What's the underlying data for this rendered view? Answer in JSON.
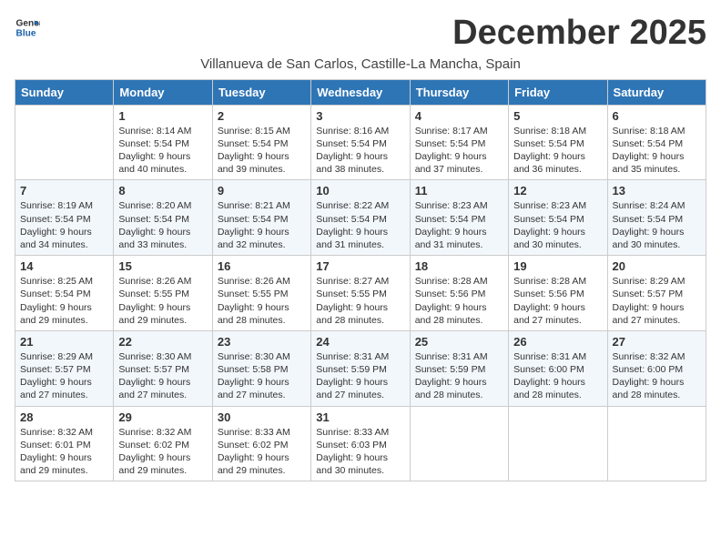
{
  "logo": {
    "line1": "General",
    "line2": "Blue"
  },
  "title": "December 2025",
  "subtitle": "Villanueva de San Carlos, Castille-La Mancha, Spain",
  "days_of_week": [
    "Sunday",
    "Monday",
    "Tuesday",
    "Wednesday",
    "Thursday",
    "Friday",
    "Saturday"
  ],
  "weeks": [
    [
      {
        "day": "",
        "content": ""
      },
      {
        "day": "1",
        "content": "Sunrise: 8:14 AM\nSunset: 5:54 PM\nDaylight: 9 hours\nand 40 minutes."
      },
      {
        "day": "2",
        "content": "Sunrise: 8:15 AM\nSunset: 5:54 PM\nDaylight: 9 hours\nand 39 minutes."
      },
      {
        "day": "3",
        "content": "Sunrise: 8:16 AM\nSunset: 5:54 PM\nDaylight: 9 hours\nand 38 minutes."
      },
      {
        "day": "4",
        "content": "Sunrise: 8:17 AM\nSunset: 5:54 PM\nDaylight: 9 hours\nand 37 minutes."
      },
      {
        "day": "5",
        "content": "Sunrise: 8:18 AM\nSunset: 5:54 PM\nDaylight: 9 hours\nand 36 minutes."
      },
      {
        "day": "6",
        "content": "Sunrise: 8:18 AM\nSunset: 5:54 PM\nDaylight: 9 hours\nand 35 minutes."
      }
    ],
    [
      {
        "day": "7",
        "content": "Sunrise: 8:19 AM\nSunset: 5:54 PM\nDaylight: 9 hours\nand 34 minutes."
      },
      {
        "day": "8",
        "content": "Sunrise: 8:20 AM\nSunset: 5:54 PM\nDaylight: 9 hours\nand 33 minutes."
      },
      {
        "day": "9",
        "content": "Sunrise: 8:21 AM\nSunset: 5:54 PM\nDaylight: 9 hours\nand 32 minutes."
      },
      {
        "day": "10",
        "content": "Sunrise: 8:22 AM\nSunset: 5:54 PM\nDaylight: 9 hours\nand 31 minutes."
      },
      {
        "day": "11",
        "content": "Sunrise: 8:23 AM\nSunset: 5:54 PM\nDaylight: 9 hours\nand 31 minutes."
      },
      {
        "day": "12",
        "content": "Sunrise: 8:23 AM\nSunset: 5:54 PM\nDaylight: 9 hours\nand 30 minutes."
      },
      {
        "day": "13",
        "content": "Sunrise: 8:24 AM\nSunset: 5:54 PM\nDaylight: 9 hours\nand 30 minutes."
      }
    ],
    [
      {
        "day": "14",
        "content": "Sunrise: 8:25 AM\nSunset: 5:54 PM\nDaylight: 9 hours\nand 29 minutes."
      },
      {
        "day": "15",
        "content": "Sunrise: 8:26 AM\nSunset: 5:55 PM\nDaylight: 9 hours\nand 29 minutes."
      },
      {
        "day": "16",
        "content": "Sunrise: 8:26 AM\nSunset: 5:55 PM\nDaylight: 9 hours\nand 28 minutes."
      },
      {
        "day": "17",
        "content": "Sunrise: 8:27 AM\nSunset: 5:55 PM\nDaylight: 9 hours\nand 28 minutes."
      },
      {
        "day": "18",
        "content": "Sunrise: 8:28 AM\nSunset: 5:56 PM\nDaylight: 9 hours\nand 28 minutes."
      },
      {
        "day": "19",
        "content": "Sunrise: 8:28 AM\nSunset: 5:56 PM\nDaylight: 9 hours\nand 27 minutes."
      },
      {
        "day": "20",
        "content": "Sunrise: 8:29 AM\nSunset: 5:57 PM\nDaylight: 9 hours\nand 27 minutes."
      }
    ],
    [
      {
        "day": "21",
        "content": "Sunrise: 8:29 AM\nSunset: 5:57 PM\nDaylight: 9 hours\nand 27 minutes."
      },
      {
        "day": "22",
        "content": "Sunrise: 8:30 AM\nSunset: 5:57 PM\nDaylight: 9 hours\nand 27 minutes."
      },
      {
        "day": "23",
        "content": "Sunrise: 8:30 AM\nSunset: 5:58 PM\nDaylight: 9 hours\nand 27 minutes."
      },
      {
        "day": "24",
        "content": "Sunrise: 8:31 AM\nSunset: 5:59 PM\nDaylight: 9 hours\nand 27 minutes."
      },
      {
        "day": "25",
        "content": "Sunrise: 8:31 AM\nSunset: 5:59 PM\nDaylight: 9 hours\nand 28 minutes."
      },
      {
        "day": "26",
        "content": "Sunrise: 8:31 AM\nSunset: 6:00 PM\nDaylight: 9 hours\nand 28 minutes."
      },
      {
        "day": "27",
        "content": "Sunrise: 8:32 AM\nSunset: 6:00 PM\nDaylight: 9 hours\nand 28 minutes."
      }
    ],
    [
      {
        "day": "28",
        "content": "Sunrise: 8:32 AM\nSunset: 6:01 PM\nDaylight: 9 hours\nand 29 minutes."
      },
      {
        "day": "29",
        "content": "Sunrise: 8:32 AM\nSunset: 6:02 PM\nDaylight: 9 hours\nand 29 minutes."
      },
      {
        "day": "30",
        "content": "Sunrise: 8:33 AM\nSunset: 6:02 PM\nDaylight: 9 hours\nand 29 minutes."
      },
      {
        "day": "31",
        "content": "Sunrise: 8:33 AM\nSunset: 6:03 PM\nDaylight: 9 hours\nand 30 minutes."
      },
      {
        "day": "",
        "content": ""
      },
      {
        "day": "",
        "content": ""
      },
      {
        "day": "",
        "content": ""
      }
    ]
  ]
}
